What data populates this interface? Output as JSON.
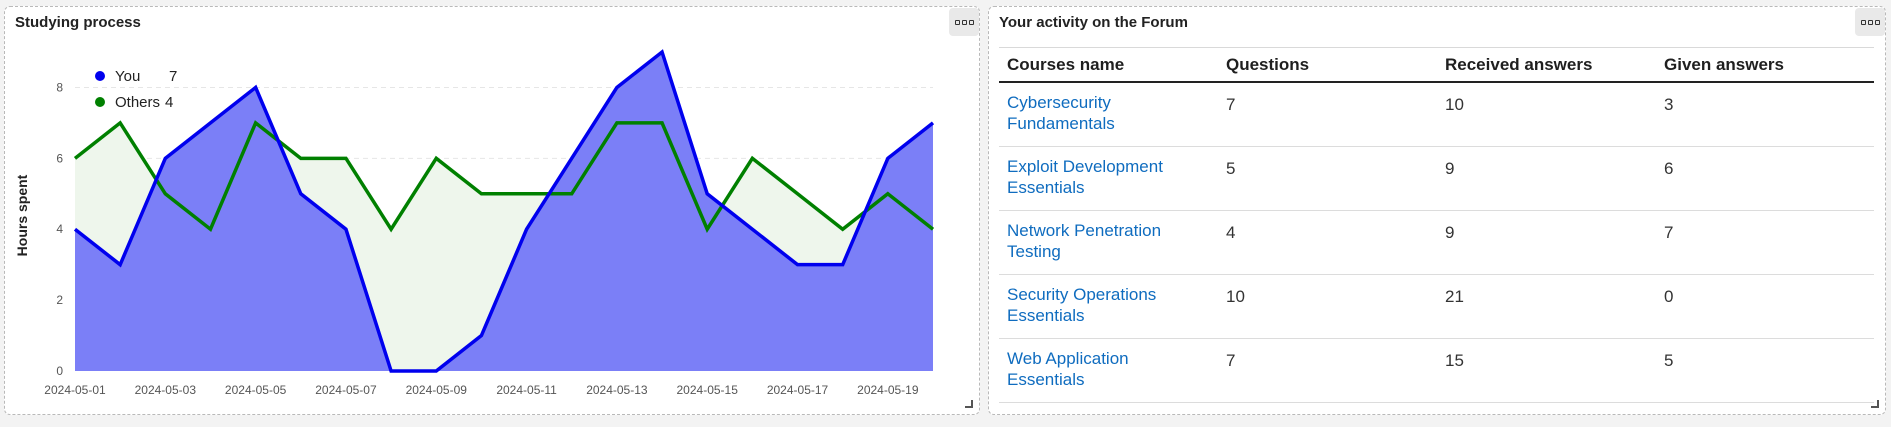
{
  "left_panel": {
    "title": "Studying process",
    "menu_icon": "three-dots-icon",
    "legend": [
      {
        "name": "You",
        "value": "7",
        "color": "#0000ee"
      },
      {
        "name": "Others",
        "value": "4",
        "color": "#008000"
      }
    ]
  },
  "right_panel": {
    "title": "Your activity on the Forum",
    "menu_icon": "three-dots-icon",
    "columns": [
      "Courses name",
      "Questions",
      "Received answers",
      "Given answers"
    ],
    "rows": [
      {
        "course": "Cybersecurity Fundamentals",
        "questions": "7",
        "received": "10",
        "given": "3"
      },
      {
        "course": "Exploit Development Essentials",
        "questions": "5",
        "received": "9",
        "given": "6"
      },
      {
        "course": "Network Penetration Testing",
        "questions": "4",
        "received": "9",
        "given": "7"
      },
      {
        "course": "Security Operations Essentials",
        "questions": "10",
        "received": "21",
        "given": "0"
      },
      {
        "course": "Web Application Essentials",
        "questions": "7",
        "received": "15",
        "given": "5"
      }
    ],
    "link_color": "#0f6cbf"
  },
  "chart_data": {
    "type": "area",
    "ylabel": "Hours spent",
    "ylim": [
      0,
      9
    ],
    "yticks": [
      0,
      2,
      4,
      6,
      8
    ],
    "x": [
      "2024-05-01",
      "2024-05-02",
      "2024-05-03",
      "2024-05-04",
      "2024-05-05",
      "2024-05-06",
      "2024-05-07",
      "2024-05-08",
      "2024-05-09",
      "2024-05-10",
      "2024-05-11",
      "2024-05-12",
      "2024-05-13",
      "2024-05-14",
      "2024-05-15",
      "2024-05-16",
      "2024-05-17",
      "2024-05-18",
      "2024-05-19",
      "2024-05-20"
    ],
    "xtick_labels": [
      "2024-05-01",
      "2024-05-03",
      "2024-05-05",
      "2024-05-07",
      "2024-05-09",
      "2024-05-11",
      "2024-05-13",
      "2024-05-15",
      "2024-05-17",
      "2024-05-19"
    ],
    "grid": true,
    "legend_position": "top-left",
    "series": [
      {
        "name": "You",
        "color": "#0000ee",
        "fill": "#7b7ff7",
        "values": [
          4,
          3,
          6,
          7,
          8,
          5,
          4,
          0,
          0,
          1,
          4,
          6,
          8,
          9,
          5,
          4,
          3,
          3,
          6,
          7
        ]
      },
      {
        "name": "Others",
        "color": "#008000",
        "fill": "#eef6ec",
        "values": [
          6,
          7,
          5,
          4,
          7,
          6,
          6,
          4,
          6,
          5,
          5,
          5,
          7,
          7,
          4,
          6,
          5,
          4,
          5,
          4
        ]
      }
    ]
  }
}
